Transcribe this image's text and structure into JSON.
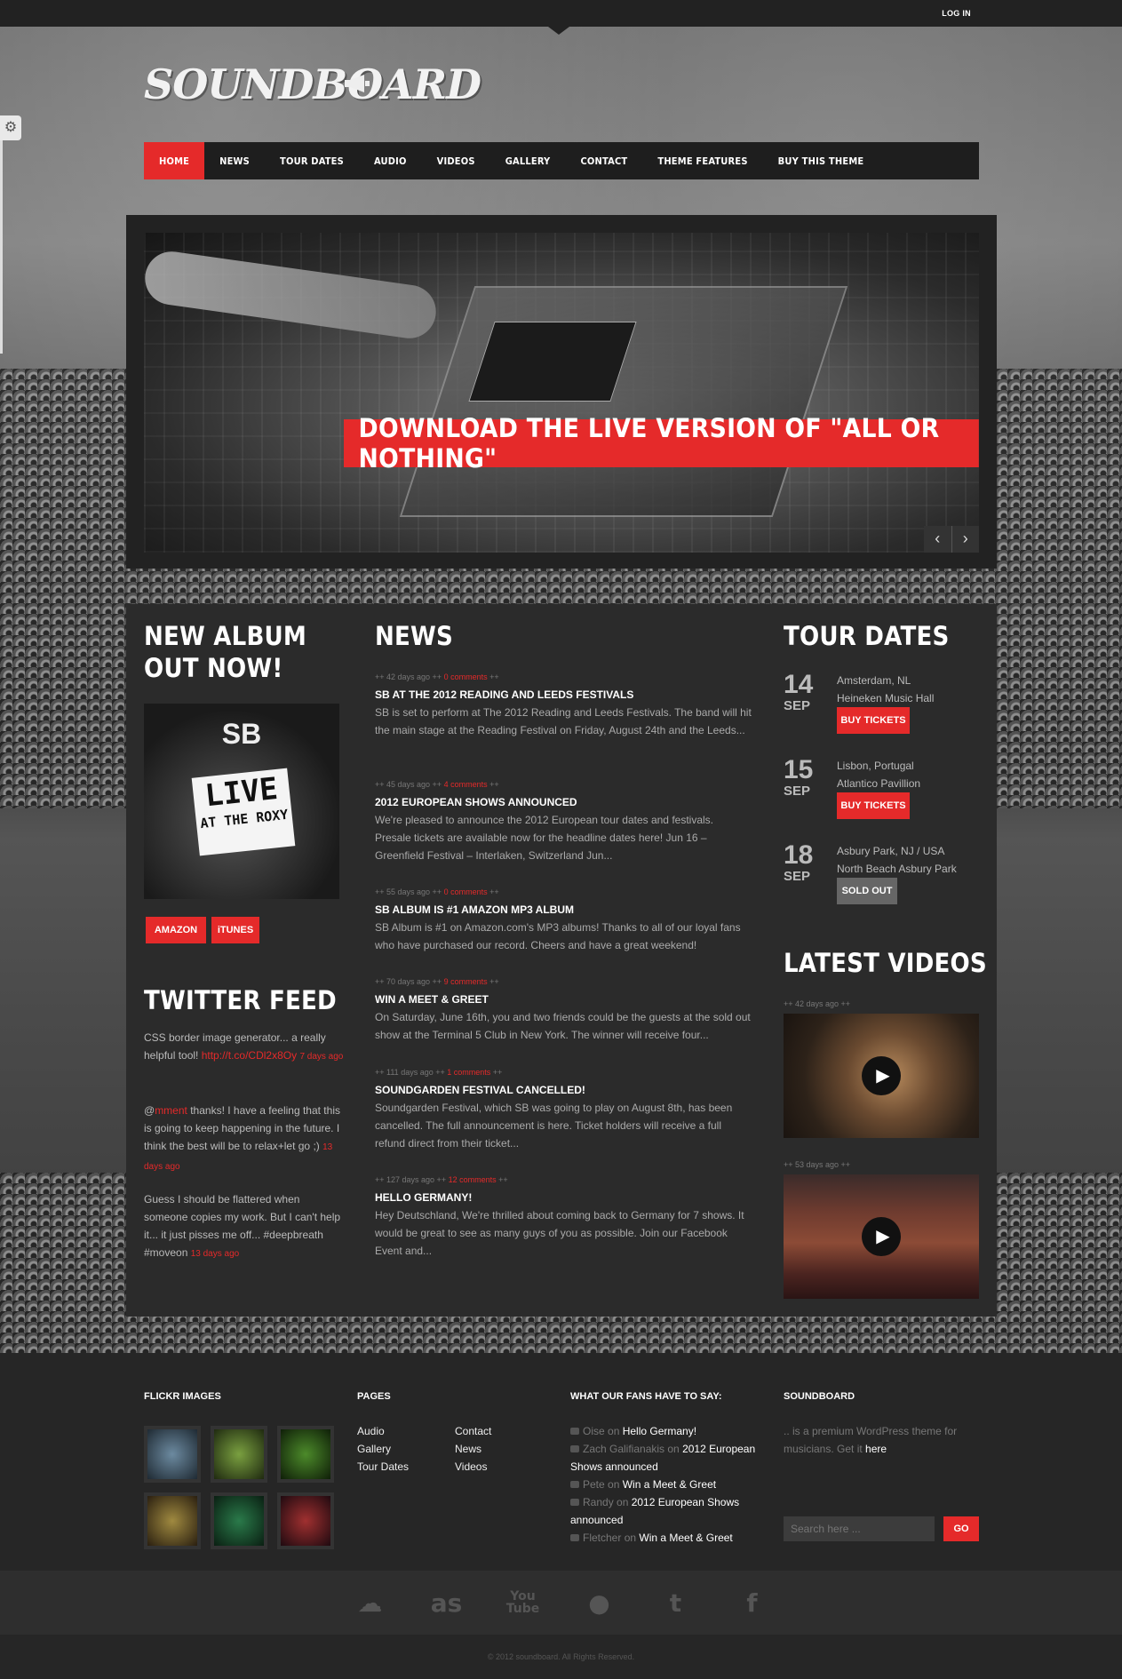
{
  "topbar": {
    "login": "LOG IN"
  },
  "brand": {
    "logo": "SOUNDBOARD"
  },
  "nav": [
    "HOME",
    "NEWS",
    "TOUR DATES",
    "AUDIO",
    "VIDEOS",
    "GALLERY",
    "CONTACT",
    "THEME FEATURES",
    "BUY THIS THEME"
  ],
  "slider": {
    "caption": "DOWNLOAD THE LIVE VERSION OF \"ALL OR NOTHING\"",
    "prev": "‹",
    "next": "›"
  },
  "album": {
    "heading_line1": "NEW ALBUM",
    "heading_line2": "OUT NOW!",
    "art_top": "SB",
    "art_live": "LIVE",
    "art_sub": "AT THE ROXY",
    "buttons": [
      "AMAZON",
      "iTUNES"
    ]
  },
  "twitter": {
    "heading": "TWITTER FEED",
    "tweets": [
      {
        "pre": "CSS border image generator... a really helpful tool! ",
        "link": "http://t.co/CDl2x8Oy",
        "mid": "",
        "post": "",
        "ago": "7 days ago"
      },
      {
        "pre": "@",
        "link": "mment",
        "mid": " thanks! I have a feeling that this is going to keep happening in the future. I think the best will be to relax+let go ;)",
        "post": "",
        "ago": "13 days ago"
      },
      {
        "pre": "Guess I should be flattered when someone copies my work. But I can't help it... it just pisses me off... #deepbreath #moveon ",
        "link": "",
        "mid": "",
        "post": "",
        "ago": "13 days ago"
      }
    ]
  },
  "news": {
    "heading": "NEWS",
    "items": [
      {
        "ago": "++ 42 days ago ++",
        "comments": "0 comments",
        "title": "SB AT THE 2012 READING AND LEEDS FESTIVALS",
        "text": "SB is set to perform at The 2012 Reading and Leeds Festivals. The band will hit the main stage at the Reading Festival on Friday, August 24th and the Leeds..."
      },
      {
        "ago": "++ 45 days ago ++",
        "comments": "4 comments",
        "title": "2012 EUROPEAN SHOWS ANNOUNCED",
        "text": "We're pleased to announce the 2012 European tour dates and festivals. Presale tickets are available now for the headline dates here! Jun 16 – Greenfield Festival – Interlaken, Switzerland Jun..."
      },
      {
        "ago": "++ 55 days ago ++",
        "comments": "0 comments",
        "title": "SB ALBUM IS #1 AMAZON MP3 ALBUM",
        "text": "SB Album is #1 on Amazon.com's MP3 albums! Thanks to all of our loyal fans who have purchased our record. Cheers and have a great weekend!"
      },
      {
        "ago": "++ 70 days ago ++",
        "comments": "9 comments",
        "title": "WIN A MEET & GREET",
        "text": "On Saturday, June 16th, you and two friends could be the guests at the sold out show at the Terminal 5 Club in New York. The winner will receive four..."
      },
      {
        "ago": "++ 111 days ago ++",
        "comments": "1 comments",
        "title": "SOUNDGARDEN FESTIVAL CANCELLED!",
        "text": "Soundgarden Festival, which SB was going to play on August 8th, has been cancelled. The full announcement is here. Ticket holders will receive a full refund direct from their ticket..."
      },
      {
        "ago": "++ 127 days ago ++",
        "comments": "12 comments",
        "title": "HELLO GERMANY!",
        "text": "Hey Deutschland, We're thrilled about coming back to Germany for 7 shows. It would be great to see as many guys of you as possible. Join our Facebook Event and..."
      }
    ]
  },
  "tour": {
    "heading": "TOUR DATES",
    "dates": [
      {
        "day": "14",
        "month": "SEP",
        "city": "Amsterdam, NL",
        "venue": "Heineken Music Hall",
        "button": "BUY TICKETS",
        "sold_out": false
      },
      {
        "day": "15",
        "month": "SEP",
        "city": "Lisbon, Portugal",
        "venue": "Atlantico Pavillion",
        "button": "BUY TICKETS",
        "sold_out": false
      },
      {
        "day": "18",
        "month": "SEP",
        "city": "Asbury Park, NJ / USA",
        "venue": "North Beach Asbury Park",
        "button": "SOLD OUT",
        "sold_out": true
      }
    ]
  },
  "videos": {
    "heading": "LATEST VIDEOS",
    "items": [
      {
        "ago": "++ 42 days ago ++"
      },
      {
        "ago": "++ 53 days ago ++"
      }
    ]
  },
  "footer": {
    "flickr_title": "FLICKR IMAGES",
    "pages_title": "PAGES",
    "pages_col1": [
      "Audio",
      "Gallery",
      "Tour Dates"
    ],
    "pages_col2": [
      "Contact",
      "News",
      "Videos"
    ],
    "fans_title": "WHAT OUR FANS HAVE TO SAY:",
    "fans": [
      {
        "name": "Oise",
        "on": " on ",
        "post": "Hello Germany!"
      },
      {
        "name": "Zach Galifianakis",
        "on": " on ",
        "post": "2012 European Shows announced"
      },
      {
        "name": "Pete",
        "on": " on ",
        "post": "Win a Meet & Greet"
      },
      {
        "name": "Randy",
        "on": " on ",
        "post": "2012 European Shows announced"
      },
      {
        "name": "Fletcher",
        "on": " on ",
        "post": "Win a Meet & Greet"
      }
    ],
    "about_title": "SOUNDBOARD",
    "about_text": ".. is a premium WordPress theme for musicians. Get it ",
    "about_link": "here",
    "search_placeholder": "Search here ...",
    "search_button": "GO",
    "social": [
      "soundcloud-icon",
      "lastfm-icon",
      "youtube-icon",
      "apple-icon",
      "tumblr-icon",
      "facebook-icon"
    ],
    "copyright": "© 2012 soundboard. All Rights Reserved."
  },
  "colors": {
    "accent": "#e52a2a",
    "dark": "#222222",
    "panel": "#2b2b2b"
  }
}
